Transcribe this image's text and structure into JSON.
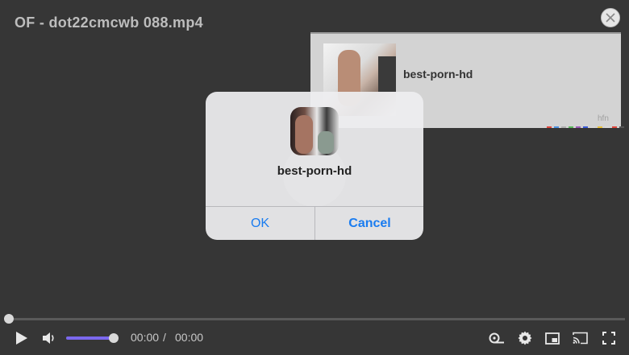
{
  "player": {
    "title": "OF - dot22cmcwb 088.mp4",
    "time_current": "00:00",
    "time_separator": "/",
    "time_total": "00:00",
    "volume_level": 0.95,
    "progress": 0,
    "accent_color": "#7b68ee"
  },
  "ad": {
    "name": "best-porn-hd",
    "brand": "hfn",
    "dot_colors": [
      "#e0463c",
      "#4a90e2",
      "#b0b0b0",
      "#5cb85c",
      "#9b59b6",
      "#3a5bd9",
      "#d8d8d8",
      "#e9c13a",
      "#d8d8d8",
      "#e0463c",
      "#555555"
    ]
  },
  "dialog": {
    "title": "best-porn-hd",
    "ok_label": "OK",
    "cancel_label": "Cancel",
    "button_color": "#1a7cf0"
  },
  "icons": {
    "close": "close-icon",
    "play": "play-icon",
    "volume": "volume-icon",
    "speed": "playback-speed-icon",
    "settings": "gear-icon",
    "pip": "picture-in-picture-icon",
    "cast": "cast-icon",
    "fullscreen": "fullscreen-icon"
  }
}
